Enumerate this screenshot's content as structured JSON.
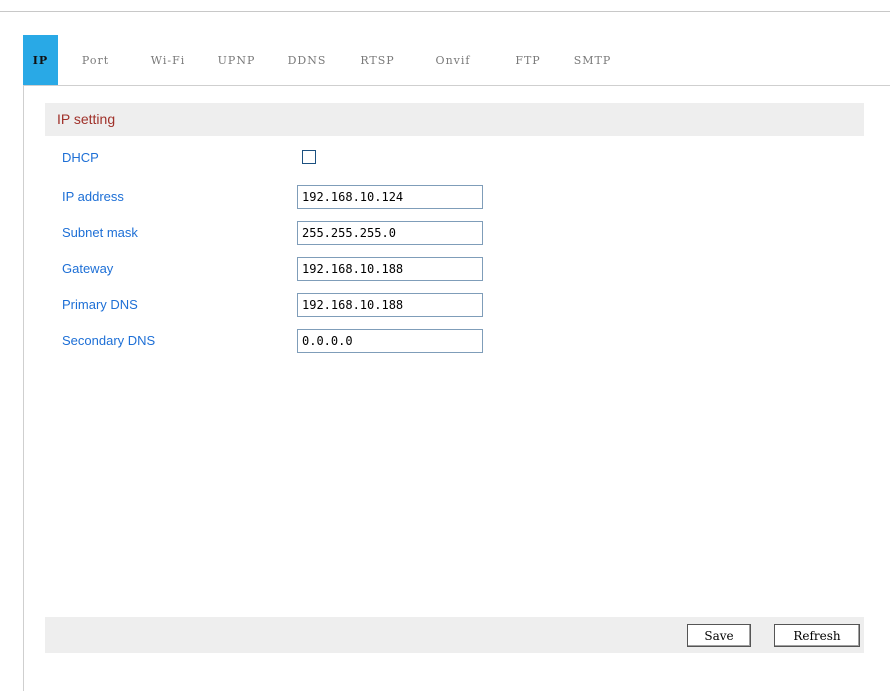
{
  "tabs": [
    {
      "label": "IP",
      "active": true
    },
    {
      "label": "Port",
      "active": false
    },
    {
      "label": "Wi-Fi",
      "active": false
    },
    {
      "label": "UPNP",
      "active": false
    },
    {
      "label": "DDNS",
      "active": false
    },
    {
      "label": "RTSP",
      "active": false
    },
    {
      "label": "Onvif",
      "active": false
    },
    {
      "label": "FTP",
      "active": false
    },
    {
      "label": "SMTP",
      "active": false
    }
  ],
  "section": {
    "title": "IP setting"
  },
  "form": {
    "dhcp": {
      "label": "DHCP",
      "checked": false
    },
    "ip_address": {
      "label": "IP address",
      "value": "192.168.10.124"
    },
    "subnet_mask": {
      "label": "Subnet mask",
      "value": "255.255.255.0"
    },
    "gateway": {
      "label": "Gateway",
      "value": "192.168.10.188"
    },
    "primary_dns": {
      "label": "Primary DNS",
      "value": "192.168.10.188"
    },
    "secondary_dns": {
      "label": "Secondary DNS",
      "value": "0.0.0.0"
    }
  },
  "buttons": {
    "save": "Save",
    "refresh": "Refresh"
  },
  "colors": {
    "active_tab": "#29a9e6",
    "label_text": "#1d6fd6",
    "section_title": "#a0312a",
    "panel_background": "#eeeeee"
  }
}
